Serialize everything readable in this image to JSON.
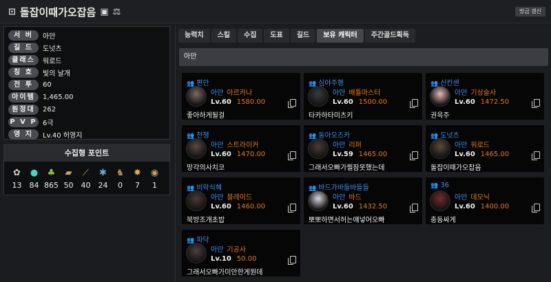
{
  "header": {
    "title": "돌잡이때가오잡음",
    "refresh_label": "방금 갱신"
  },
  "profile": [
    {
      "label": "서 버",
      "value": "아만"
    },
    {
      "label": "길 드",
      "value": "도넛츠"
    },
    {
      "label": "클래스",
      "value": "워로드"
    },
    {
      "label": "칭 호",
      "value": "빛의 날개"
    },
    {
      "label": "전 투",
      "value": "60"
    },
    {
      "label": "아이템",
      "value": "1,465.00"
    },
    {
      "label": "원정대",
      "value": "262"
    },
    {
      "label": "P V P",
      "value": "6극"
    },
    {
      "label": "영 지",
      "value": "Lv.40 허영지"
    }
  ],
  "collection": {
    "title": "수집형 포인트",
    "items": [
      {
        "icon": "mokoko-seed-icon",
        "count": "13"
      },
      {
        "icon": "island-heart-icon",
        "count": "84"
      },
      {
        "icon": "giant-heart-icon",
        "count": "865"
      },
      {
        "icon": "masterpiece-icon",
        "count": "50"
      },
      {
        "icon": "ignea-token-icon",
        "count": "40"
      },
      {
        "icon": "star-of-adventure-icon",
        "count": "24"
      },
      {
        "icon": "world-tree-leaf-icon",
        "count": "0"
      },
      {
        "icon": "voyage-seal-icon",
        "count": "7"
      },
      {
        "icon": "orpheus-star-icon",
        "count": "1"
      }
    ]
  },
  "tabs": [
    "능력치",
    "스킬",
    "수집",
    "도표",
    "길드",
    "보유 캐릭터",
    "주간골드획득"
  ],
  "active_tab": "보유 캐릭터",
  "server_header": "아만",
  "characters": [
    {
      "nick": "편안",
      "server": "아만",
      "class": "아르카나",
      "level": "Lv.60",
      "ilvl": "1580.00",
      "name": "좋아하게될걸"
    },
    {
      "nick": "심야주행",
      "server": "아만",
      "class": "배틀마스터",
      "level": "Lv.60",
      "ilvl": "1500.00",
      "name": "타카하타미츠키"
    },
    {
      "nick": "신칸센",
      "server": "아만",
      "class": "기상술사",
      "level": "Lv.60",
      "ilvl": "1472.50",
      "name": "권옥주"
    },
    {
      "nick": "전쟁",
      "server": "아만",
      "class": "스트라이커",
      "level": "Lv.60",
      "ilvl": "1470.00",
      "name": "망각의사치코"
    },
    {
      "nick": "동아오즈카",
      "server": "아만",
      "class": "리퍼",
      "level": "Lv.59",
      "ilvl": "1465.00",
      "name": "그래서오빠가찔잠못했는데"
    },
    {
      "nick": "도넛츠",
      "server": "아만",
      "class": "워로드",
      "level": "Lv.60",
      "ilvl": "1465.00",
      "name": "돌잡이때가오잡음"
    },
    {
      "nick": "비락식혜",
      "server": "아만",
      "class": "블레이드",
      "level": "Lv.60",
      "ilvl": "1460.00",
      "name": "북방조개초밥"
    },
    {
      "nick": "바드가바들바들들",
      "server": "아만",
      "class": "바드",
      "level": "Lv.60",
      "ilvl": "1432.50",
      "name": "뽀뽀하면서허는얘넣어오빠"
    },
    {
      "nick": "36",
      "server": "아만",
      "class": "데모닉",
      "level": "Lv.60",
      "ilvl": "1400.00",
      "name": "충동싸게"
    },
    {
      "nick": "파닥",
      "server": "아만",
      "class": "기공사",
      "level": "Lv.10",
      "ilvl": "50.00",
      "name": "그래서오빠가미안한게뭔데"
    }
  ]
}
